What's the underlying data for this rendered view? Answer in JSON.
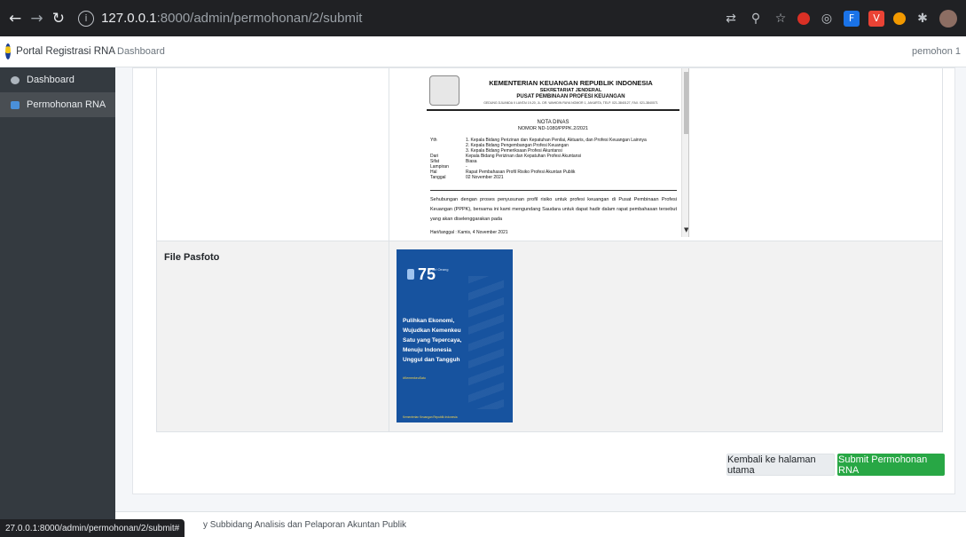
{
  "browser": {
    "url_host": "127.0.0.1",
    "url_path": ":8000/admin/permohonan/2/submit",
    "info_icon": "info-icon"
  },
  "navbar": {
    "brand": "Portal Registrasi RNA",
    "link": "Dashboard",
    "user": "pemohon 1"
  },
  "sidebar": {
    "items": [
      {
        "label": "Dashboard",
        "icon": "dashboard-icon"
      },
      {
        "label": "Permohonan RNA",
        "icon": "document-icon"
      }
    ]
  },
  "pdf": {
    "h1": "KEMENTERIAN KEUANGAN REPUBLIK INDONESIA",
    "h2": "SEKRETARIAT JENDERAL",
    "h3": "PUSAT PEMBINAAN PROFESI KEUANGAN",
    "address": "GEDUNG DJUANDA II LANTAI 19-20, JL. DR. WAHIDIN RAYA NOMOR 1, JAKARTA, TELP. 021-3840127, FAX. 021-3840071",
    "title": "NOTA DINAS",
    "number": "NOMOR ND-1080/PPPK.2/2021",
    "yth_key": "Yth",
    "yth_1": "1. Kepala Bidang Perizinan dan Kepatuhan Penilai, Aktuaris, dan Profesi Keuangan Lainnya",
    "yth_2": "2. Kepala Bidang Pengembangan Profesi Keuangan",
    "yth_3": "3. Kepala Bidang Pemeriksaan Profesi Akuntansi",
    "dari_key": "Dari",
    "dari_val": "Kepala Bidang Perizinan dan Kepatuhan Profesi Akuntansi",
    "sifat_key": "Sifat",
    "sifat_val": "Biasa",
    "lampiran_key": "Lampiran",
    "lampiran_val": "-",
    "hal_key": "Hal",
    "hal_val": "Rapat Pembahasan Profil Risiko Profesi Akuntan Publik",
    "tanggal_key": "Tanggal",
    "tanggal_val": "02 November 2021",
    "body": "Sehubungan dengan proses penyusunan profil risiko untuk profesi keuangan di Pusat Pembinaan Profesi Keuangan (PPPK), bersama ini kami mengundang Saudara untuk dapat hadir dalam rapat pembahasan tersebut yang akan diselenggarakan pada",
    "foot": "Hari/tanggal  :  Kamis, 4 November 2021"
  },
  "table": {
    "pasfoto_label": "File Pasfoto"
  },
  "photo": {
    "number": "75",
    "tag": "Hari Oeang",
    "lines": [
      "Pulihkan Ekonomi,",
      "Wujudkan Kemenkeu",
      "Satu yang Tepercaya,",
      "Menuju Indonesia",
      "Unggul dan Tangguh"
    ],
    "hashtag": "#KemenkeuSatu",
    "bottom": "Kementerian Keuangan Republik Indonesia"
  },
  "buttons": {
    "back": "Kembali ke halaman utama",
    "submit": "Submit Permohonan RNA"
  },
  "footer": {
    "text": "y Subbidang Analisis dan Pelaporan Akuntan Publik"
  },
  "status_bar": {
    "url": "27.0.0.1:8000/admin/permohonan/2/submit#"
  },
  "colors": {
    "sidebar": "#343a40",
    "submit": "#28a745",
    "photo_bg": "#17539f"
  }
}
